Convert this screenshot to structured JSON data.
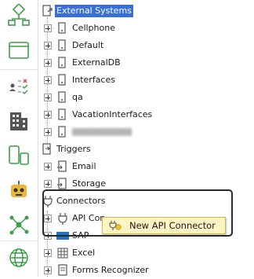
{
  "rail": {
    "items": [
      {
        "name": "workflow-icon"
      },
      {
        "name": "forms-icon"
      },
      {
        "name": "rules-icon"
      },
      {
        "name": "building-icon"
      },
      {
        "name": "devices-icon"
      },
      {
        "name": "bot-icon"
      },
      {
        "name": "network-icon"
      },
      {
        "name": "globe-icon"
      }
    ]
  },
  "tree": {
    "root": {
      "label": "External Systems"
    },
    "external_systems": [
      {
        "label": "Cellphone"
      },
      {
        "label": "Default"
      },
      {
        "label": "ExternalDB"
      },
      {
        "label": "Interfaces"
      },
      {
        "label": "qa"
      },
      {
        "label": "VacationInterfaces"
      }
    ],
    "triggers": {
      "label": "Triggers",
      "children": [
        {
          "label": "Email"
        },
        {
          "label": "Storage"
        }
      ]
    },
    "connectors": {
      "label": "Connectors",
      "children": [
        {
          "label": "API Con"
        },
        {
          "label": "SAP"
        },
        {
          "label": "Excel"
        },
        {
          "label": "Forms Recognizer"
        }
      ]
    }
  },
  "context_menu": {
    "item_label": "New API Connector"
  },
  "colors": {
    "selection": "#3a6fd8",
    "popup_bg": "#fff4c4",
    "rail_icon": "#3f9e4a"
  }
}
